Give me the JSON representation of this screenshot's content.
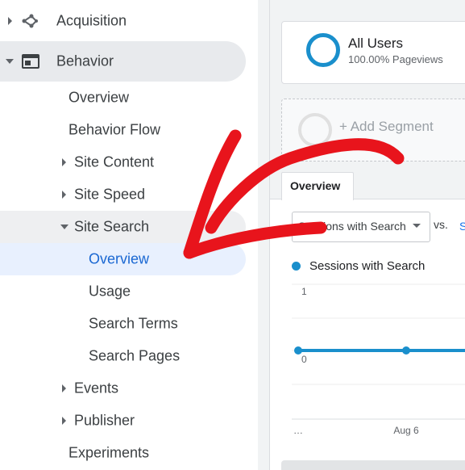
{
  "sidebar": {
    "acquisition": "Acquisition",
    "behavior": "Behavior",
    "items": {
      "overview": "Overview",
      "behavior_flow": "Behavior Flow",
      "site_content": "Site Content",
      "site_speed": "Site Speed",
      "site_search": "Site Search",
      "site_search_overview": "Overview",
      "usage": "Usage",
      "search_terms": "Search Terms",
      "search_pages": "Search Pages",
      "events": "Events",
      "publisher": "Publisher",
      "experiments": "Experiments"
    }
  },
  "segments": {
    "all_users": "All Users",
    "pageviews_pct": "100.00% Pageviews",
    "add_segment": "+ Add Segment"
  },
  "tabs": {
    "overview": "Overview"
  },
  "metric_select": {
    "value": "Sessions with Search"
  },
  "compare": {
    "vs": "vs.",
    "vs_next": "S"
  },
  "legend": {
    "series": "Sessions with Search"
  },
  "colors": {
    "accent": "#1a8fcc",
    "annotation_arrow": "#e8141c",
    "active_nav": "#1967d2"
  },
  "chart_data": {
    "type": "line",
    "y_ticks": [
      "1",
      "0"
    ],
    "x_ticks": [
      "…",
      "Aug 6"
    ],
    "series": [
      {
        "name": "Sessions with Search",
        "values": [
          0,
          0,
          0
        ]
      }
    ],
    "ylim": [
      0,
      1
    ],
    "grid": true
  }
}
